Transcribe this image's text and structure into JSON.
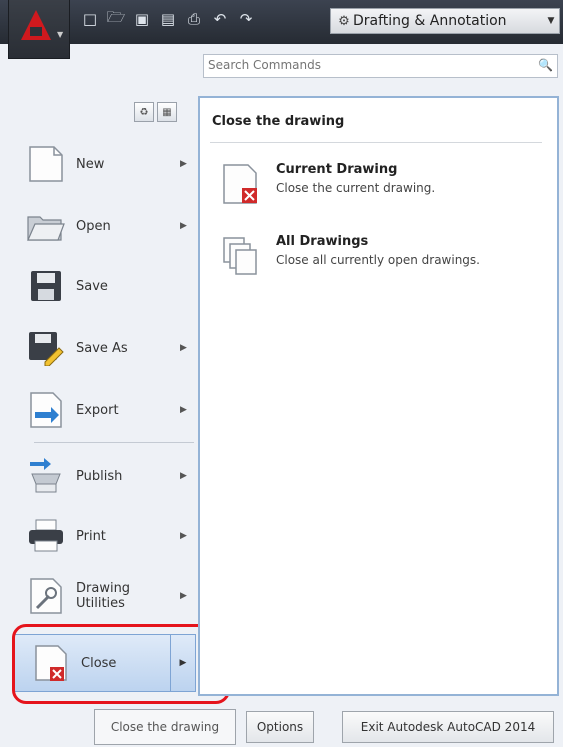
{
  "header": {
    "workspace_label": "Drafting & Annotation",
    "qat_icons": [
      "new-icon",
      "open-icon",
      "save-icon",
      "save-as-icon",
      "print-icon",
      "undo-icon",
      "redo-icon"
    ]
  },
  "search": {
    "placeholder": "Search Commands"
  },
  "menu": {
    "items": [
      {
        "label": "New",
        "icon": "new-document-icon",
        "has_submenu": true
      },
      {
        "label": "Open",
        "icon": "open-folder-icon",
        "has_submenu": true
      },
      {
        "label": "Save",
        "icon": "floppy-disk-icon",
        "has_submenu": false
      },
      {
        "label": "Save As",
        "icon": "save-as-icon",
        "has_submenu": true
      },
      {
        "label": "Export",
        "icon": "export-icon",
        "has_submenu": true
      },
      {
        "label": "Publish",
        "icon": "publish-icon",
        "has_submenu": true
      },
      {
        "label": "Print",
        "icon": "printer-icon",
        "has_submenu": true
      },
      {
        "label": "Drawing Utilities",
        "icon": "drawing-utilities-icon",
        "has_submenu": true
      },
      {
        "label": "Close",
        "icon": "close-drawing-icon",
        "has_submenu": true,
        "active": true
      }
    ]
  },
  "panel": {
    "title": "Close the drawing",
    "entries": [
      {
        "title": "Current Drawing",
        "description": "Close the current drawing.",
        "icon": "current-drawing-close-icon"
      },
      {
        "title": "All Drawings",
        "description": "Close all currently open drawings.",
        "icon": "all-drawings-icon"
      }
    ]
  },
  "footer": {
    "tooltip": "Close the drawing",
    "options_label": "Options",
    "exit_label": "Exit Autodesk AutoCAD 2014"
  },
  "colors": {
    "accent": "#d0191e",
    "highlight": "#e5141c",
    "panel_border": "#94b3d6"
  }
}
